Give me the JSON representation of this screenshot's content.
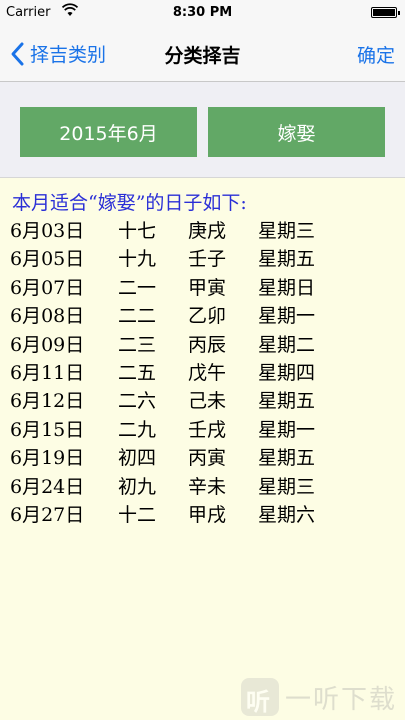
{
  "status_bar": {
    "carrier": "Carrier",
    "time": "8:30 PM"
  },
  "nav": {
    "back_label": "择吉类别",
    "title": "分类择吉",
    "confirm_label": "确定"
  },
  "controls": {
    "month_label": "2015年6月",
    "event_label": "嫁娶"
  },
  "results": {
    "heading": "本月适合“嫁娶”的日子如下:",
    "rows": [
      {
        "date": "6月03日",
        "lunar": "十七",
        "ganzhi": "庚戌",
        "weekday": "星期三"
      },
      {
        "date": "6月05日",
        "lunar": "十九",
        "ganzhi": "壬子",
        "weekday": "星期五"
      },
      {
        "date": "6月07日",
        "lunar": "二一",
        "ganzhi": "甲寅",
        "weekday": "星期日"
      },
      {
        "date": "6月08日",
        "lunar": "二二",
        "ganzhi": "乙卯",
        "weekday": "星期一"
      },
      {
        "date": "6月09日",
        "lunar": "二三",
        "ganzhi": "丙辰",
        "weekday": "星期二"
      },
      {
        "date": "6月11日",
        "lunar": "二五",
        "ganzhi": "戊午",
        "weekday": "星期四"
      },
      {
        "date": "6月12日",
        "lunar": "二六",
        "ganzhi": "己未",
        "weekday": "星期五"
      },
      {
        "date": "6月15日",
        "lunar": "二九",
        "ganzhi": "壬戌",
        "weekday": "星期一"
      },
      {
        "date": "6月19日",
        "lunar": "初四",
        "ganzhi": "丙寅",
        "weekday": "星期五"
      },
      {
        "date": "6月24日",
        "lunar": "初九",
        "ganzhi": "辛未",
        "weekday": "星期三"
      },
      {
        "date": "6月27日",
        "lunar": "十二",
        "ganzhi": "甲戌",
        "weekday": "星期六"
      }
    ]
  },
  "watermark": {
    "logo_glyph": "听",
    "text": "一听下载"
  },
  "colors": {
    "accent": "#1a73e8",
    "button_green": "#62a866",
    "heading_blue": "#2a2fd6",
    "result_bg": "#fdfde4"
  }
}
